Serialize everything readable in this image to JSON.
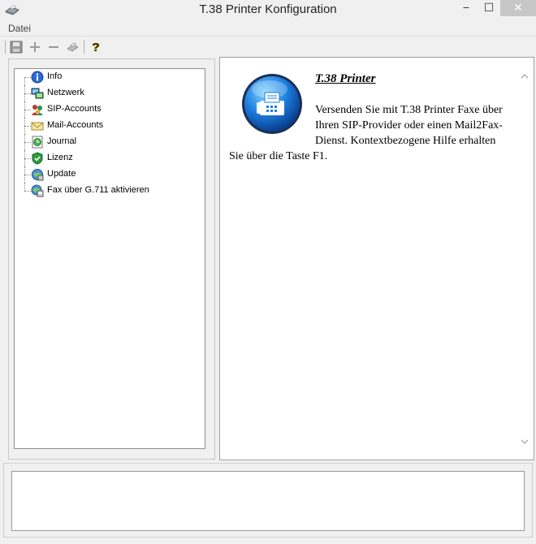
{
  "window": {
    "title": "T.38 Printer Konfiguration"
  },
  "window_controls": {
    "minimize": "−",
    "maximize": "☐",
    "close": "✕"
  },
  "menu": {
    "items": [
      {
        "label": "Datei"
      }
    ]
  },
  "toolbar": {
    "icons": [
      "save-icon",
      "add-icon",
      "remove-icon",
      "print-icon",
      "help-icon"
    ],
    "help_glyph": "?"
  },
  "tree": {
    "items": [
      {
        "label": "Info",
        "icon": "info-icon"
      },
      {
        "label": "Netzwerk",
        "icon": "network-icon"
      },
      {
        "label": "SIP-Accounts",
        "icon": "sip-accounts-icon"
      },
      {
        "label": "Mail-Accounts",
        "icon": "mail-icon"
      },
      {
        "label": "Journal",
        "icon": "journal-icon"
      },
      {
        "label": "Lizenz",
        "icon": "license-shield-icon"
      },
      {
        "label": "Update",
        "icon": "update-icon"
      },
      {
        "label": "Fax über G.711 aktivieren",
        "icon": "fax-g711-icon"
      }
    ]
  },
  "content": {
    "title": "T.38 Printer",
    "body": "Versenden Sie mit T.38 Printer Faxe über Ihren SIP-Provider oder einen Mail2Fax-Dienst. Kontextbezogene Hilfe erhalten Sie über die Taste F1."
  },
  "status": {
    "text": ""
  }
}
